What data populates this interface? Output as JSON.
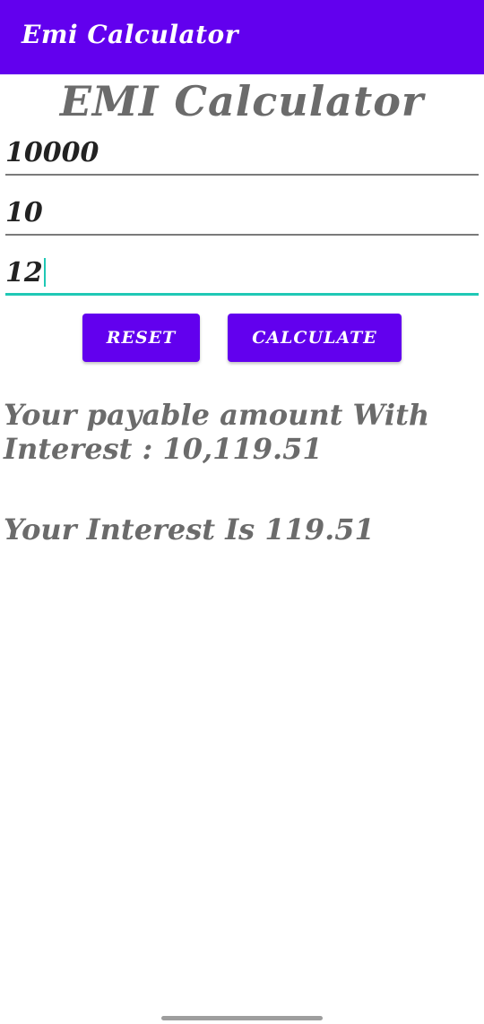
{
  "app_bar": {
    "title": "Emi Calculator",
    "color": "#6200ee"
  },
  "heading": "EMI Calculator",
  "fields": [
    {
      "value": "10000"
    },
    {
      "value": "10"
    },
    {
      "value": "12",
      "focused": true
    }
  ],
  "buttons": {
    "reset_label": "RESET",
    "calculate_label": "CALCULATE"
  },
  "results": {
    "payable": "Your payable amount With Interest : 10,119.51",
    "interest": "Your Interest Is 119.51"
  },
  "colors": {
    "accent": "#6200ee",
    "focus": "#1fc8b5",
    "text_gray": "#6b6b6b"
  }
}
